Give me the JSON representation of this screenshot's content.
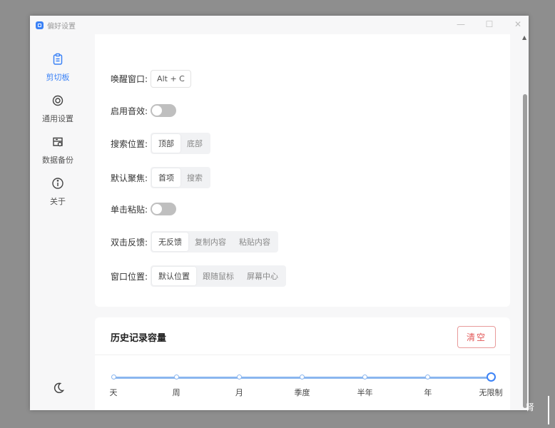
{
  "window": {
    "title": "偏好设置"
  },
  "window_controls": {
    "minimize": "—",
    "maximize": "☐",
    "close": "✕"
  },
  "sidebar": {
    "items": [
      {
        "label": "剪切板",
        "icon": "clipboard-icon",
        "active": true
      },
      {
        "label": "通用设置",
        "icon": "settings-icon",
        "active": false
      },
      {
        "label": "数据备份",
        "icon": "database-icon",
        "active": false
      },
      {
        "label": "关于",
        "icon": "info-icon",
        "active": false
      }
    ],
    "theme_icon": "moon-icon"
  },
  "settings": {
    "wake_window": {
      "label": "唤醒窗口:",
      "value": "Alt + C"
    },
    "sound": {
      "label": "启用音效:",
      "on": false
    },
    "search_position": {
      "label": "搜索位置:",
      "options": [
        "顶部",
        "底部"
      ],
      "selected": "顶部"
    },
    "default_focus": {
      "label": "默认聚焦:",
      "options": [
        "首项",
        "搜索"
      ],
      "selected": "首项"
    },
    "single_click_paste": {
      "label": "单击粘贴:",
      "on": false
    },
    "double_click": {
      "label": "双击反馈:",
      "options": [
        "无反馈",
        "复制内容",
        "粘贴内容"
      ],
      "selected": "无反馈"
    },
    "window_position": {
      "label": "窗口位置:",
      "options": [
        "默认位置",
        "跟随鼠标",
        "屏幕中心"
      ],
      "selected": "默认位置"
    }
  },
  "history": {
    "title": "历史记录容量",
    "clear_label": "清空",
    "marks": [
      "天",
      "周",
      "月",
      "季度",
      "半年",
      "年",
      "无限制"
    ],
    "selected": "无限制"
  },
  "colors": {
    "accent": "#3b82f6",
    "danger": "#e25555"
  },
  "outside": {
    "glyph": "肾"
  }
}
